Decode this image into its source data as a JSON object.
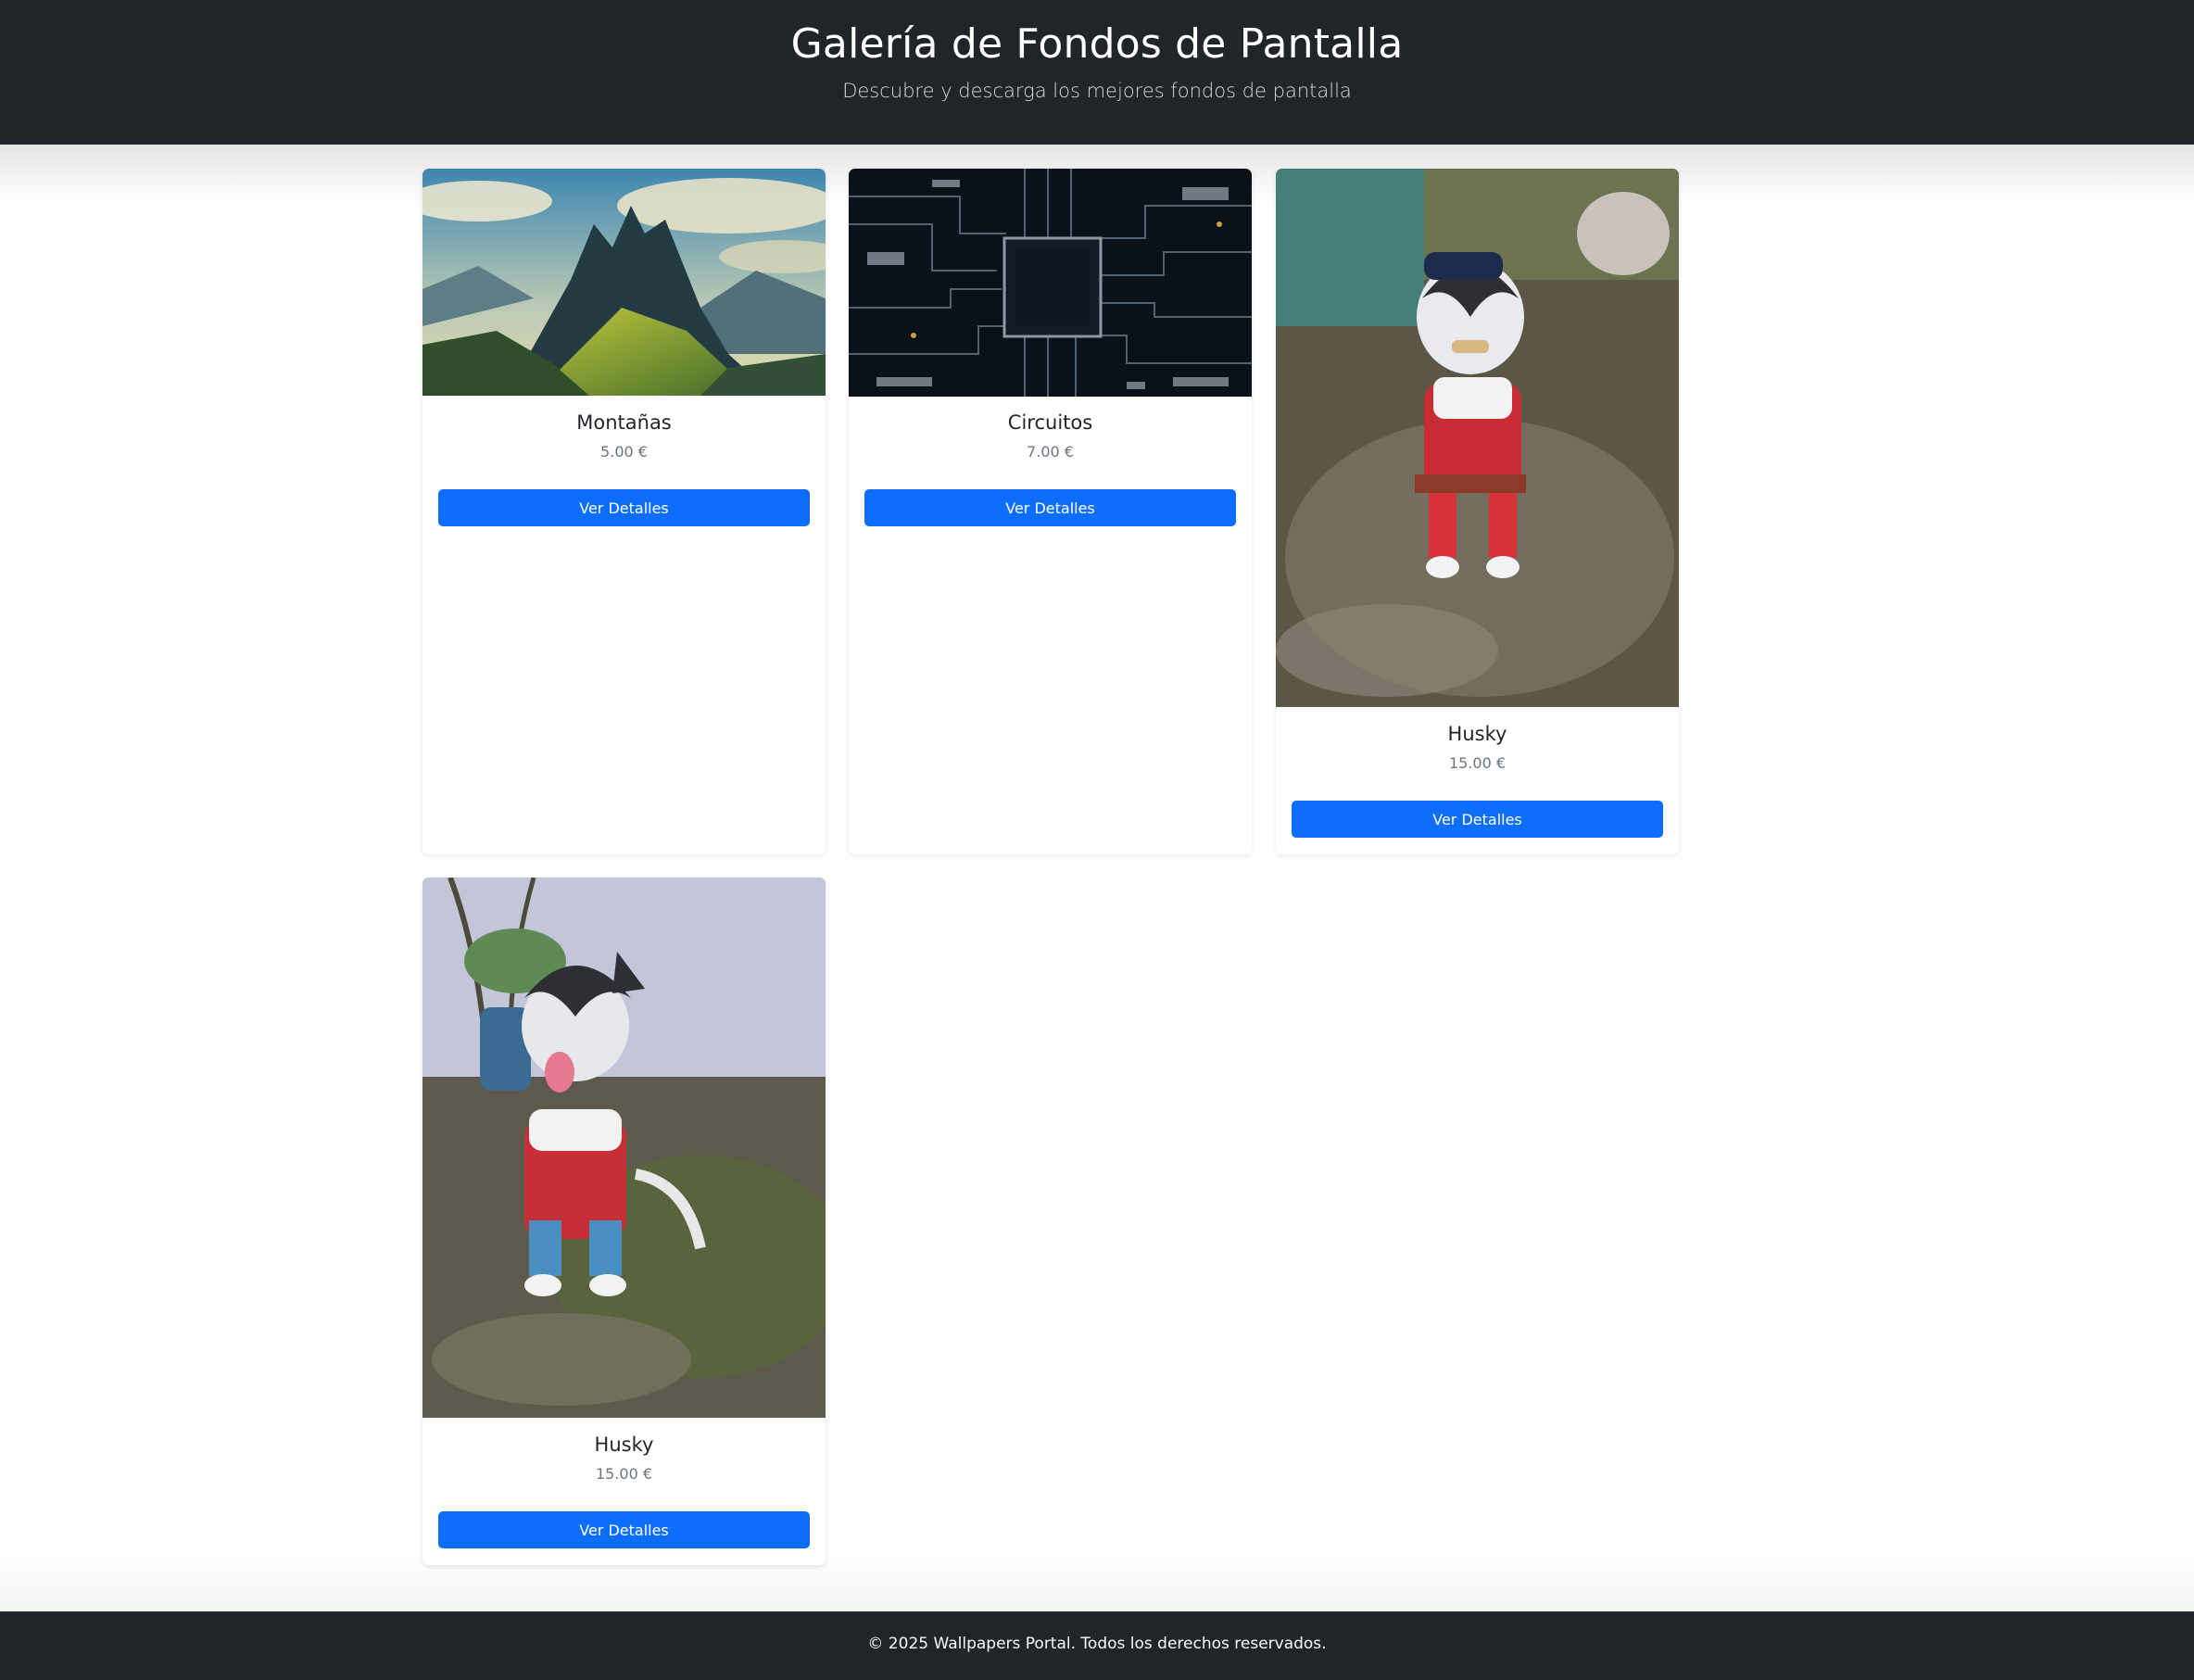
{
  "header": {
    "title": "Galería de Fondos de Pantalla",
    "subtitle": "Descubre y descarga los mejores fondos de pantalla"
  },
  "gallery": {
    "items": [
      {
        "title": "Montañas",
        "price": "5.00 €",
        "button_label": "Ver Detalles",
        "image": "mountain-landscape-image"
      },
      {
        "title": "Circuitos",
        "price": "7.00 €",
        "button_label": "Ver Detalles",
        "image": "circuit-board-image"
      },
      {
        "title": "Husky",
        "price": "15.00 €",
        "button_label": "Ver Detalles",
        "image": "husky-costume-image"
      },
      {
        "title": "Husky",
        "price": "15.00 €",
        "button_label": "Ver Detalles",
        "image": "husky-costume-image"
      }
    ]
  },
  "footer": {
    "text": "© 2025 Wallpapers Portal. Todos los derechos reservados."
  },
  "colors": {
    "header_bg": "#212529",
    "button_bg": "#0d6efd",
    "price_text": "#6c757d"
  }
}
